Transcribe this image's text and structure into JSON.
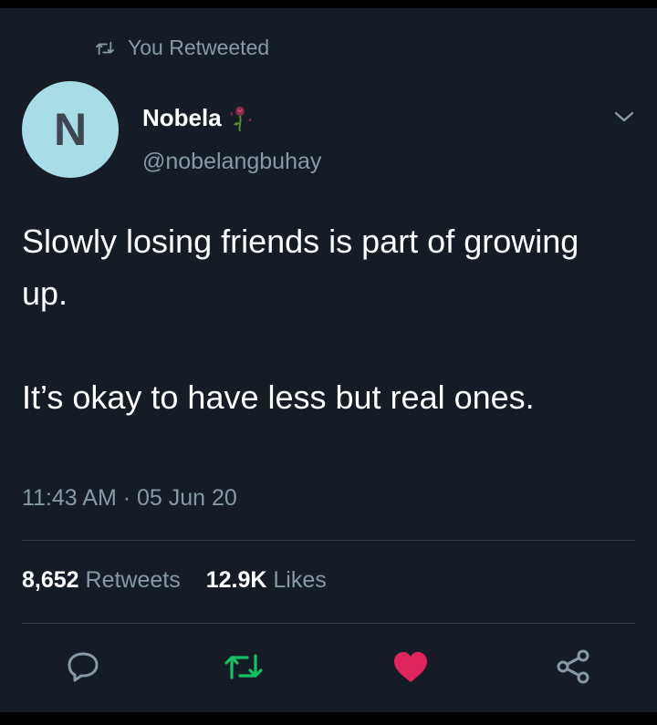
{
  "retweet_notice": "You Retweeted",
  "user": {
    "avatar_letter": "N",
    "name": "Nobela",
    "name_emoji": "wilted-rose-icon",
    "handle": "@nobelangbuhay"
  },
  "tweet": {
    "paragraphs": [
      "Slowly losing friends is part of growing up.",
      "It’s okay to have less but real ones."
    ],
    "timestamp": "11:43 AM · 05 Jun 20"
  },
  "stats": {
    "retweets_count": "8,652",
    "retweets_label": "Retweets",
    "likes_count": "12.9K",
    "likes_label": "Likes"
  },
  "actions": [
    "reply-icon",
    "retweet-icon",
    "like-icon",
    "share-icon"
  ],
  "colors": {
    "background": "#151c26",
    "secondary_text": "#8899a6",
    "retweet_active": "#17bf63",
    "like_active": "#e0245e",
    "avatar_bg": "#a8dce6"
  }
}
